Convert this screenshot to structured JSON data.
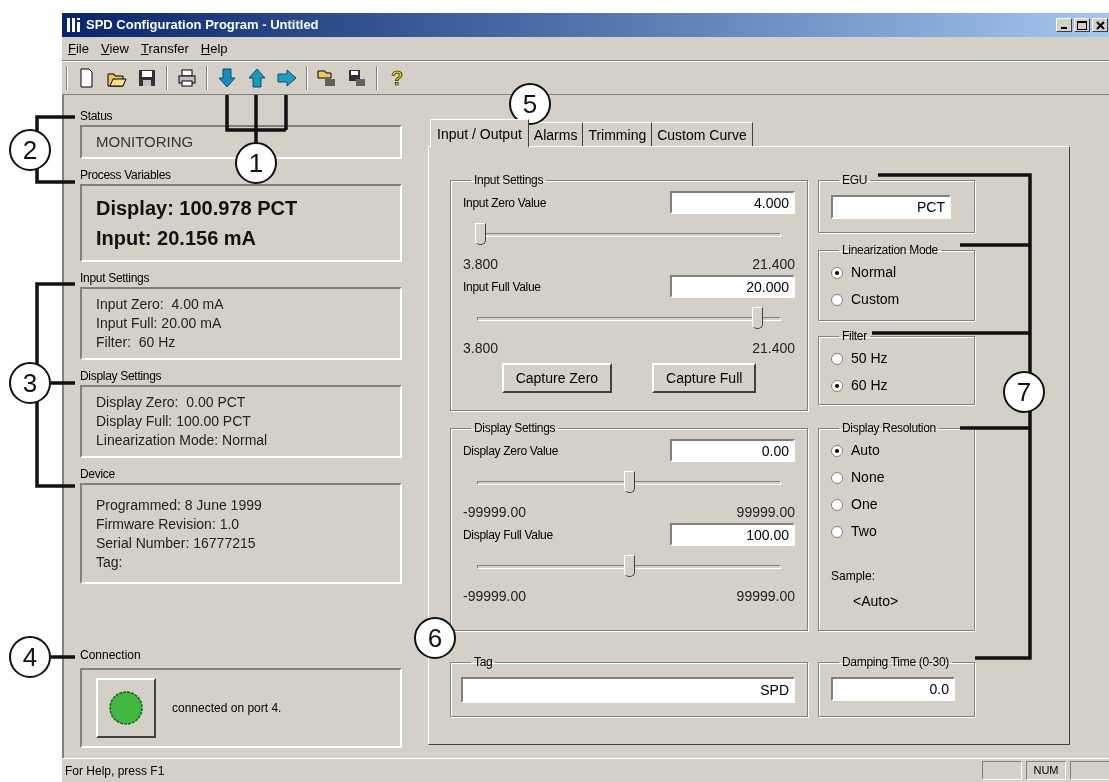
{
  "window": {
    "title": "SPD Configuration Program - Untitled"
  },
  "menu": [
    {
      "label": "File"
    },
    {
      "label": "View"
    },
    {
      "label": "Transfer"
    },
    {
      "label": "Help"
    }
  ],
  "toolbar": {
    "help_glyph": "?"
  },
  "left_panel": [
    {
      "title": "Status",
      "kind": "status",
      "lines": [
        "MONITORING"
      ]
    },
    {
      "title": "Process Variables",
      "kind": "big",
      "lines": [
        "Display: 100.978 PCT",
        "Input: 20.156 mA"
      ]
    },
    {
      "title": "Input Settings",
      "kind": "info",
      "lines": [
        "Input Zero:  4.00 mA",
        "Input Full: 20.00 mA",
        "Filter:  60 Hz"
      ]
    },
    {
      "title": "Display Settings",
      "kind": "info",
      "lines": [
        "Display Zero:  0.00 PCT",
        "Display Full: 100.00 PCT",
        "Linearization Mode: Normal"
      ]
    },
    {
      "title": "Device",
      "kind": "device",
      "lines": [
        "Programmed: 8 June 1999",
        "Firmware Revision: 1.0",
        "Serial Number: 16777215",
        "Tag:"
      ]
    }
  ],
  "connection": {
    "title": "Connection",
    "message": "connected on port 4."
  },
  "tabs": [
    {
      "label": "Input / Output",
      "selected": true
    },
    {
      "label": "Alarms",
      "selected": false
    },
    {
      "label": "Trimming",
      "selected": false
    },
    {
      "label": "Custom Curve",
      "selected": false
    }
  ],
  "input_settings": {
    "title": "Input Settings",
    "fields": [
      {
        "label": "Input Zero Value",
        "value": "4.000",
        "level": 0.011,
        "min": "3.800",
        "max": "21.400"
      },
      {
        "label": "Input Full Value",
        "value": "20.000",
        "level": 0.92,
        "min": "3.800",
        "max": "21.400"
      }
    ],
    "buttons": [
      "Capture Zero",
      "Capture Full"
    ]
  },
  "display_settings": {
    "title": "Display Settings",
    "fields": [
      {
        "label": "Display Zero Value",
        "value": "0.00",
        "level": 0.5,
        "min": "-99999.00",
        "max": "99999.00"
      },
      {
        "label": "Display Full Value",
        "value": "100.00",
        "level": 0.5005,
        "min": "-99999.00",
        "max": "99999.00"
      }
    ]
  },
  "tag": {
    "title": "Tag",
    "value": "SPD"
  },
  "egu": {
    "title": "EGU",
    "value": "PCT"
  },
  "linearization_mode": {
    "title": "Linearization Mode",
    "options": [
      {
        "label": "Normal",
        "selected": true
      },
      {
        "label": "Custom",
        "selected": false
      }
    ]
  },
  "filter": {
    "title": "Filter",
    "options": [
      {
        "label": "50 Hz",
        "selected": false
      },
      {
        "label": "60 Hz",
        "selected": true
      }
    ]
  },
  "display_resolution": {
    "title": "Display Resolution",
    "options": [
      {
        "label": "Auto",
        "selected": true
      },
      {
        "label": "None",
        "selected": false
      },
      {
        "label": "One",
        "selected": false
      },
      {
        "label": "Two",
        "selected": false
      }
    ],
    "sample_label": "Sample:",
    "sample_value": "<Auto>"
  },
  "damping_time": {
    "title": "Damping Time (0-30)",
    "value": "0.0"
  },
  "status_bar": {
    "text": "For Help, press F1",
    "indicator": "NUM"
  },
  "callouts": [
    "1",
    "2",
    "3",
    "4",
    "5",
    "6",
    "7"
  ]
}
